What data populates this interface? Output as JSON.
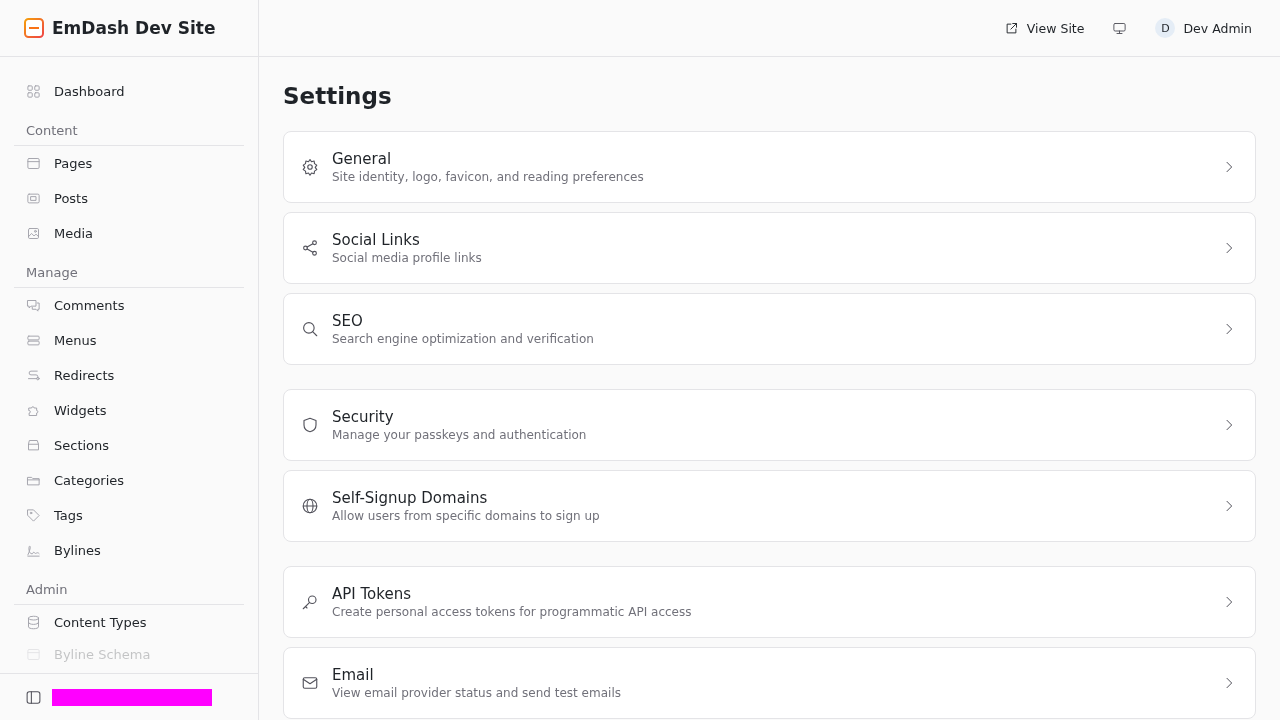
{
  "brand": {
    "title": "EmDash Dev Site"
  },
  "sidebar": {
    "sections": [
      {
        "items": [
          {
            "label": "Dashboard",
            "kind": "grid",
            "faded": false
          }
        ]
      },
      {
        "label": "Content",
        "items": [
          {
            "label": "Pages",
            "kind": "page",
            "faded": false
          },
          {
            "label": "Posts",
            "kind": "post",
            "faded": false
          },
          {
            "label": "Media",
            "kind": "image",
            "faded": false
          }
        ]
      },
      {
        "label": "Manage",
        "items": [
          {
            "label": "Comments",
            "kind": "comments",
            "faded": false
          },
          {
            "label": "Menus",
            "kind": "menus",
            "faded": false
          },
          {
            "label": "Redirects",
            "kind": "redirect",
            "faded": false
          },
          {
            "label": "Widgets",
            "kind": "puzzle",
            "faded": false
          },
          {
            "label": "Sections",
            "kind": "sections",
            "faded": false
          },
          {
            "label": "Categories",
            "kind": "folder",
            "faded": false
          },
          {
            "label": "Tags",
            "kind": "tag",
            "faded": false
          },
          {
            "label": "Bylines",
            "kind": "signature",
            "faded": false
          }
        ]
      },
      {
        "label": "Admin",
        "items": [
          {
            "label": "Content Types",
            "kind": "database",
            "faded": false
          },
          {
            "label": "Byline Schema",
            "kind": "page",
            "faded": true
          }
        ]
      }
    ]
  },
  "topbar": {
    "view_site": "View Site",
    "user_initial": "D",
    "user_name": "Dev Admin"
  },
  "page": {
    "title": "Settings",
    "groups": [
      [
        {
          "title": "General",
          "description": "Site identity, logo, favicon, and reading preferences",
          "kind": "gear"
        },
        {
          "title": "Social Links",
          "description": "Social media profile links",
          "kind": "share"
        },
        {
          "title": "SEO",
          "description": "Search engine optimization and verification",
          "kind": "search"
        }
      ],
      [
        {
          "title": "Security",
          "description": "Manage your passkeys and authentication",
          "kind": "shield"
        },
        {
          "title": "Self-Signup Domains",
          "description": "Allow users from specific domains to sign up",
          "kind": "globe"
        }
      ],
      [
        {
          "title": "API Tokens",
          "description": "Create personal access tokens for programmatic API access",
          "kind": "key"
        },
        {
          "title": "Email",
          "description": "View email provider status and send test emails",
          "kind": "mail"
        }
      ]
    ]
  }
}
